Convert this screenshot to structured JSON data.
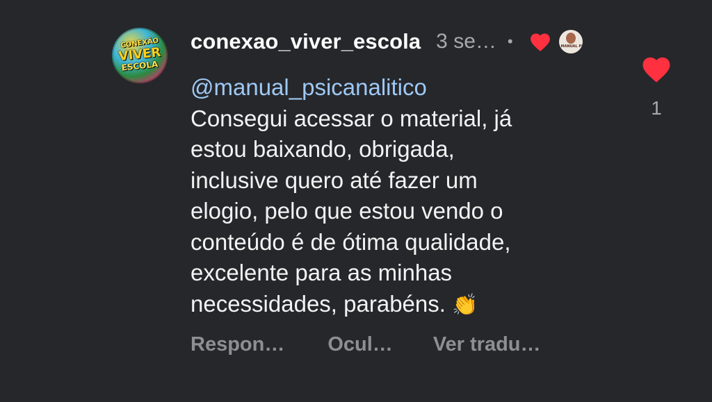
{
  "comment": {
    "avatar": {
      "icon": "profile-avatar-image",
      "lines": [
        "CONEXÃO",
        "VIVER",
        "ESCOLA"
      ]
    },
    "username": "conexao_viver_escola",
    "time": "3 se…",
    "separator": "•",
    "creator_liked_icon": "red-heart-icon",
    "creator_avatar": {
      "icon": "creator-avatar-image",
      "caption": "MANUAL PSICO"
    },
    "mention": "@manual_psicanalitico",
    "body_lines": [
      "Consegui acessar o material, já",
      "estou baixando, obrigada,",
      "inclusive quero até fazer um",
      "elogio, pelo que estou vendo o",
      "conteúdo é de ótima qualidade,",
      "excelente para as minhas",
      "necessidades, parabéns."
    ],
    "emoji": "👏",
    "actions": {
      "reply": "Respon…",
      "hide": "Ocul…",
      "translate": "Ver tradu…"
    },
    "like": {
      "icon": "heart-icon",
      "liked": true,
      "count": "1"
    },
    "colors": {
      "background": "#26272b",
      "heart": "#ff3040",
      "mention": "#9ec9f5",
      "secondary_text": "#a8a9ad"
    }
  }
}
